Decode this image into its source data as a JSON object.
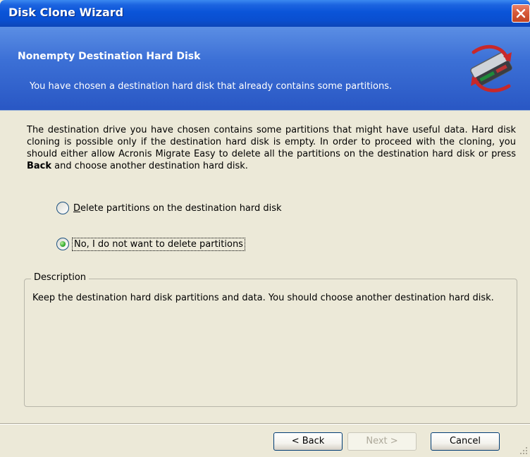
{
  "window": {
    "title": "Disk Clone Wizard"
  },
  "header": {
    "title": "Nonempty Destination Hard Disk",
    "subtitle": "You have chosen a destination hard disk that already contains some partitions."
  },
  "body": {
    "text_part1": "The destination drive you have chosen contains some partitions that might have useful data. Hard disk cloning is possible only if the destination hard disk is empty. In order to proceed with the cloning, you should either allow ",
    "product_name": "Acronis Migrate Easy",
    "text_part2": " to delete all the partitions on the destination hard disk or press ",
    "back_word": "Back",
    "text_part3": " and choose another destination hard disk."
  },
  "options": {
    "delete_label": "Delete partitions on the destination hard disk",
    "keep_label": "No, I do not want to delete partitions",
    "selected": "keep"
  },
  "description": {
    "legend": "Description",
    "text": "Keep the destination hard disk partitions and data. You should choose another destination hard disk."
  },
  "buttons": {
    "back": "< Back",
    "next": "Next >",
    "cancel": "Cancel"
  },
  "icons": {
    "close": "close-icon",
    "header": "hard-disk-clone-icon",
    "grip": "resize-grip-icon"
  },
  "colors": {
    "titlebar": "#0a54d8",
    "header": "#3c70d6",
    "dialog_bg": "#ece9d8",
    "close": "#d75a3a"
  }
}
